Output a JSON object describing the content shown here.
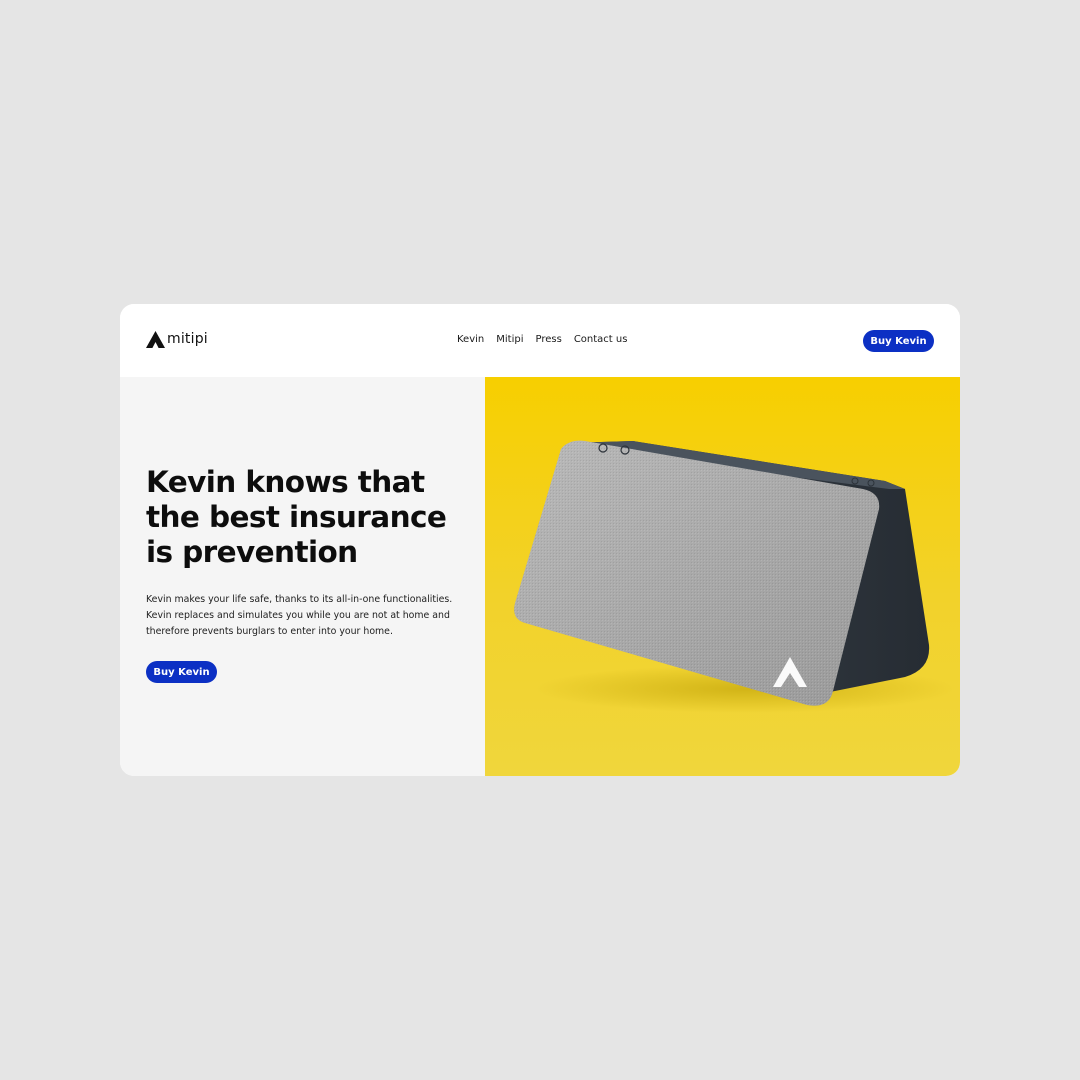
{
  "brand": {
    "name": "mitipi",
    "logo_icon": "mitipi-a-logo-icon"
  },
  "nav": {
    "items": [
      "Kevin",
      "Mitipi",
      "Press",
      "Contact us"
    ]
  },
  "header": {
    "cta_label": "Buy Kevin"
  },
  "hero": {
    "headline_lines": [
      "Kevin knows that",
      "the best insurance",
      "is prevention"
    ],
    "body_lines": [
      "Kevin makes your life safe, thanks to its all-in-one functionalities.",
      "Kevin replaces and simulates you while you are not at home and",
      "therefore prevents burglars to enter into your home."
    ],
    "cta_label": "Buy Kevin",
    "image": "kevin-device-product-photo"
  },
  "colors": {
    "page_background": "#e5e5e5",
    "card_background": "#ffffff",
    "hero_left_background": "#f5f5f5",
    "accent": "#0c30c4",
    "photo_background": "#f5cd0c"
  }
}
